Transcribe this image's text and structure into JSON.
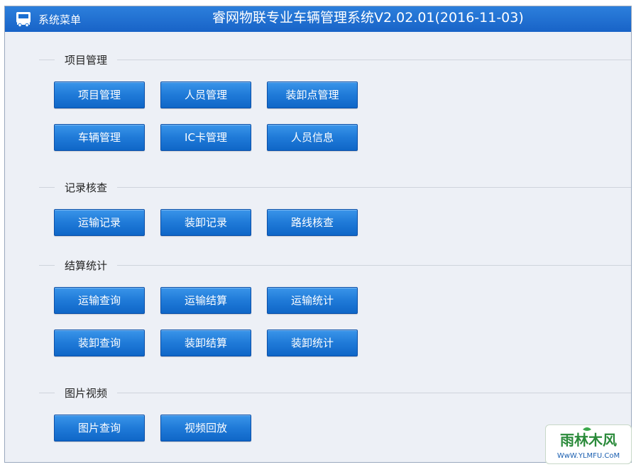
{
  "titlebar": {
    "menu_label": "系统菜单",
    "title": "睿网物联专业车辆管理系统V2.02.01(2016-11-03)",
    "app_icon": "truck-icon"
  },
  "sections": [
    {
      "title": "项目管理",
      "buttons": [
        "项目管理",
        "人员管理",
        "装卸点管理",
        "车辆管理",
        "IC卡管理",
        "人员信息"
      ]
    },
    {
      "title": "记录核查",
      "buttons": [
        "运输记录",
        "装卸记录",
        "路线核查"
      ]
    },
    {
      "title": "结算统计",
      "buttons": [
        "运输查询",
        "运输结算",
        "运输统计",
        "装卸查询",
        "装卸结算",
        "装卸统计"
      ]
    },
    {
      "title": "图片视频",
      "buttons": [
        "图片查询",
        "视频回放"
      ]
    }
  ],
  "watermark": {
    "name": "雨林木风",
    "url": "WwW.YLMFU.CoM"
  },
  "colors": {
    "titlebar": "#1a6fd2",
    "button": "#1f7ad8",
    "background": "#edf0f6"
  }
}
